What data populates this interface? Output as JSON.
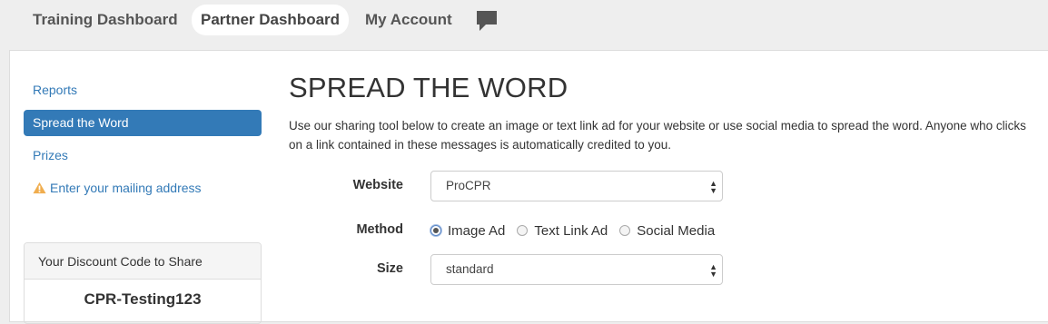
{
  "topnav": {
    "items": [
      {
        "label": "Training Dashboard"
      },
      {
        "label": "Partner Dashboard",
        "active": true
      },
      {
        "label": "My Account"
      }
    ],
    "chat_icon": "chat-bubble-icon"
  },
  "sidebar": {
    "items": [
      {
        "label": "Reports"
      },
      {
        "label": "Spread the Word",
        "active": true
      },
      {
        "label": "Prizes"
      },
      {
        "label": "Enter your mailing address",
        "icon": "warning-icon"
      }
    ],
    "discount": {
      "heading": "Your Discount Code to Share",
      "code": "CPR-Testing123"
    }
  },
  "main": {
    "title": "SPREAD THE WORD",
    "intro": "Use our sharing tool below to create an image or text link ad for your website or use social media to spread the word. Anyone who clicks on a link contained in these messages is automatically credited to you.",
    "form": {
      "website_label": "Website",
      "website_value": "ProCPR",
      "method_label": "Method",
      "method_options": [
        {
          "label": "Image Ad",
          "checked": true
        },
        {
          "label": "Text Link Ad",
          "checked": false
        },
        {
          "label": "Social Media",
          "checked": false
        }
      ],
      "size_label": "Size",
      "size_value": "standard"
    }
  },
  "colors": {
    "accent": "#337ab7",
    "warning": "#f0ad4e",
    "background": "#eeeeee"
  }
}
